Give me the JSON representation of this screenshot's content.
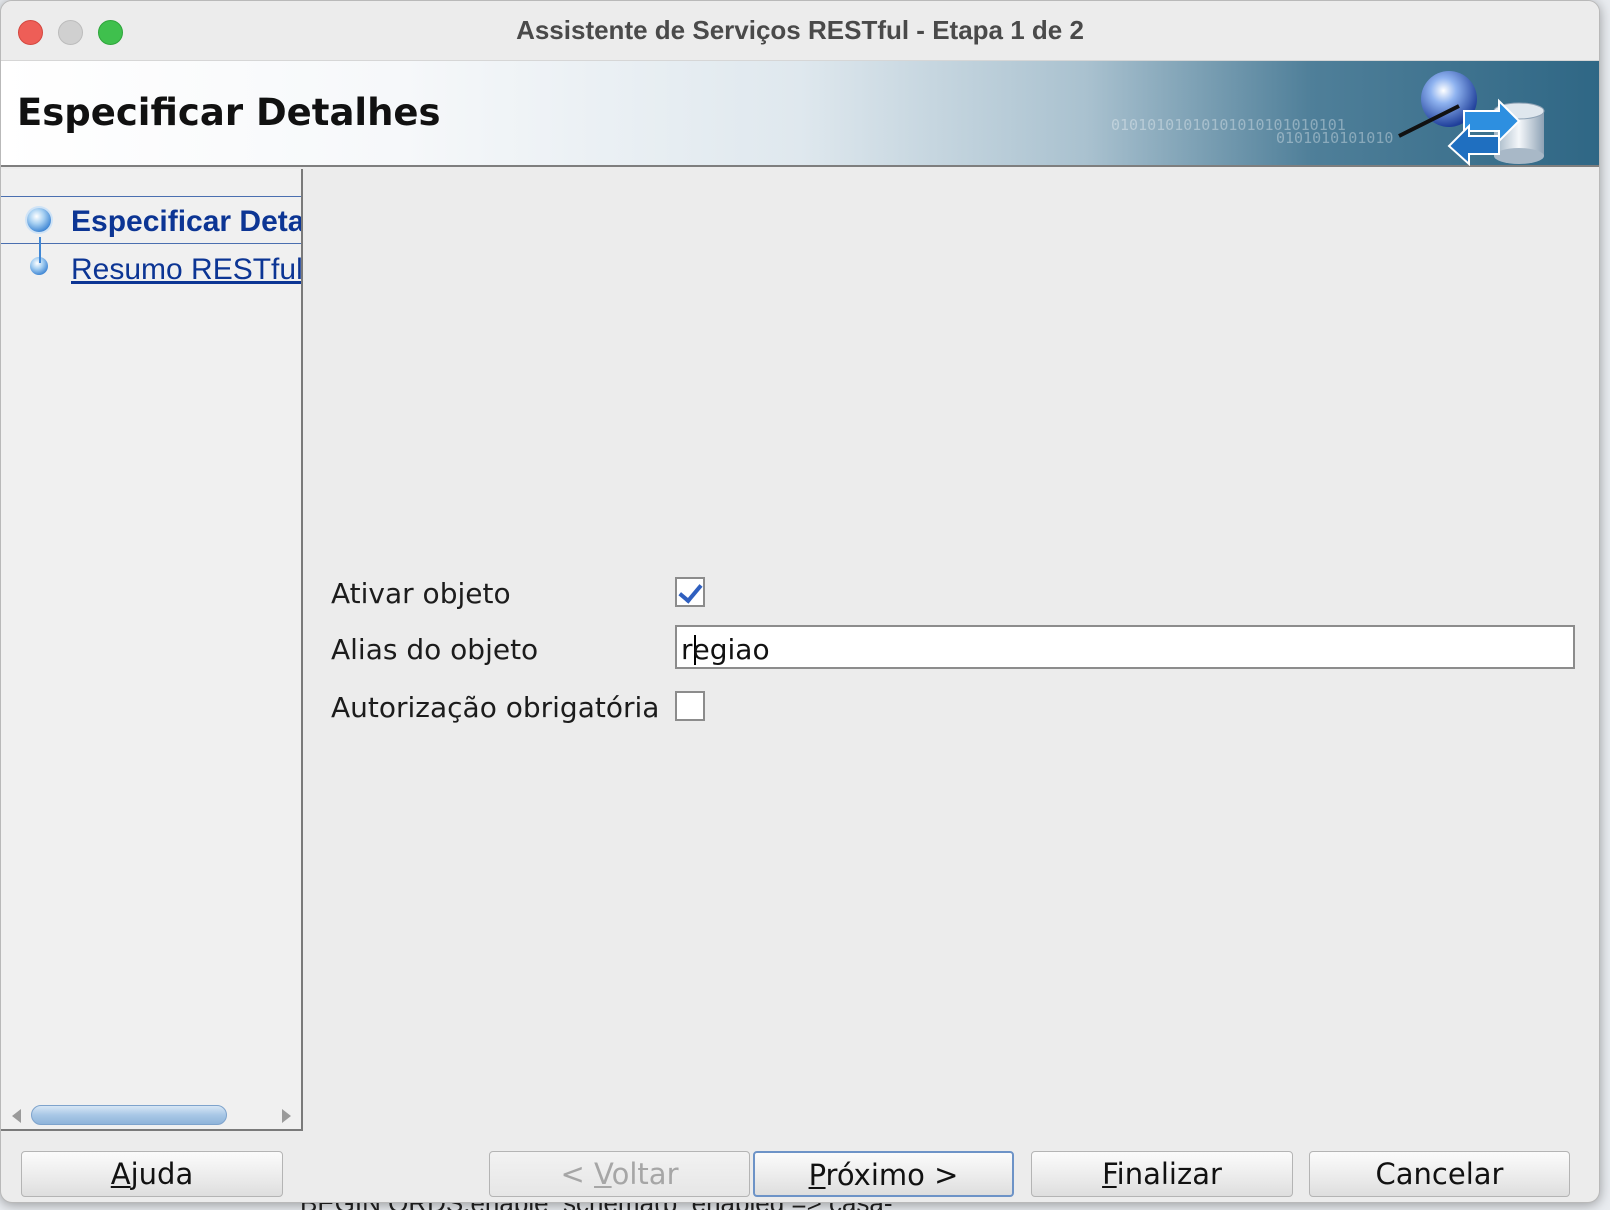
{
  "window": {
    "title": "Assistente de Serviços RESTful - Etapa 1 de 2"
  },
  "banner": {
    "title": "Especificar Detalhes",
    "binary_line_1": "01010101010101010101010101",
    "binary_line_2": "0101010101010"
  },
  "steps": [
    {
      "label": "Especificar Detalhes",
      "state": "current"
    },
    {
      "label": "Resumo RESTful",
      "state": "link"
    }
  ],
  "form": {
    "enable_object": {
      "label": "Ativar objeto",
      "checked": true
    },
    "object_alias": {
      "label": "Alias do objeto",
      "value_prefix": "r",
      "value_suffix": "egiao"
    },
    "authorization_required": {
      "label": "Autorização obrigatória",
      "checked": false
    }
  },
  "buttons": {
    "help": {
      "mnemonic": "A",
      "rest": "juda"
    },
    "back": {
      "prefix": "< ",
      "mnemonic": "V",
      "rest": "oltar",
      "enabled": false
    },
    "next": {
      "mnemonic": "P",
      "rest": "róximo >"
    },
    "finish": {
      "mnemonic": "F",
      "rest": "inalizar"
    },
    "cancel": {
      "label": "Cancelar"
    }
  },
  "background": {
    "text": "BEGIN  ORDS.enable_schema(p_enabled          =>  casa-"
  },
  "colors": {
    "accent": "#0c3594",
    "checkbox_check": "#2f5fbf",
    "banner_dark": "#2f6785"
  },
  "icons": [
    "close-icon",
    "minimize-icon",
    "maximize-icon",
    "globe-icon",
    "transfer-arrows-icon",
    "database-icon",
    "step-bullet-icon",
    "scroll-left-icon",
    "scroll-right-icon",
    "checkmark-icon"
  ]
}
